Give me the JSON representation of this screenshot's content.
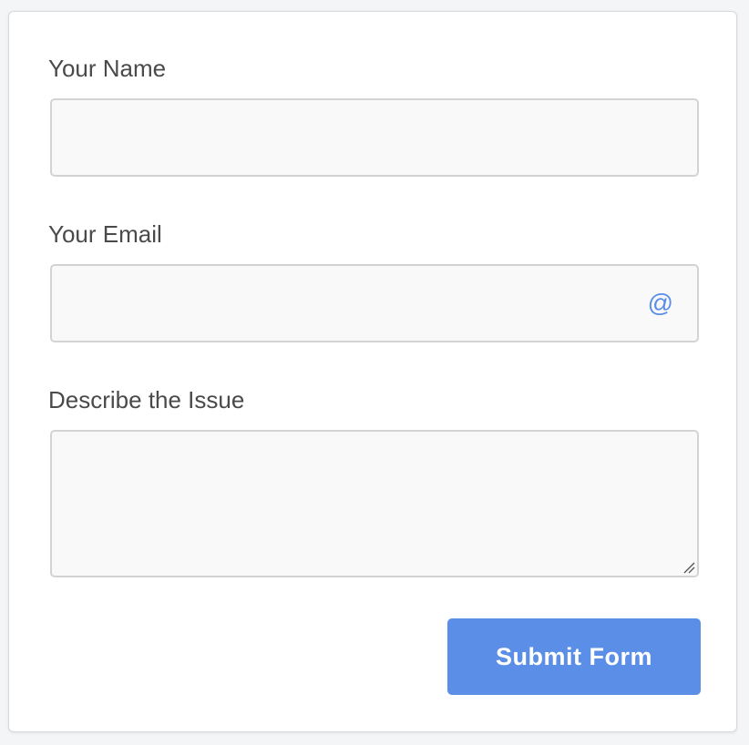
{
  "form": {
    "name_label": "Your Name",
    "name_value": "",
    "email_label": "Your Email",
    "email_value": "",
    "email_icon": "@",
    "issue_label": "Describe the Issue",
    "issue_value": "",
    "submit_label": "Submit Form"
  },
  "colors": {
    "accent": "#5b8ee6",
    "field_bg": "#f9f9f9",
    "field_border": "#d3d3d3",
    "label_text": "#4a4a4a"
  }
}
